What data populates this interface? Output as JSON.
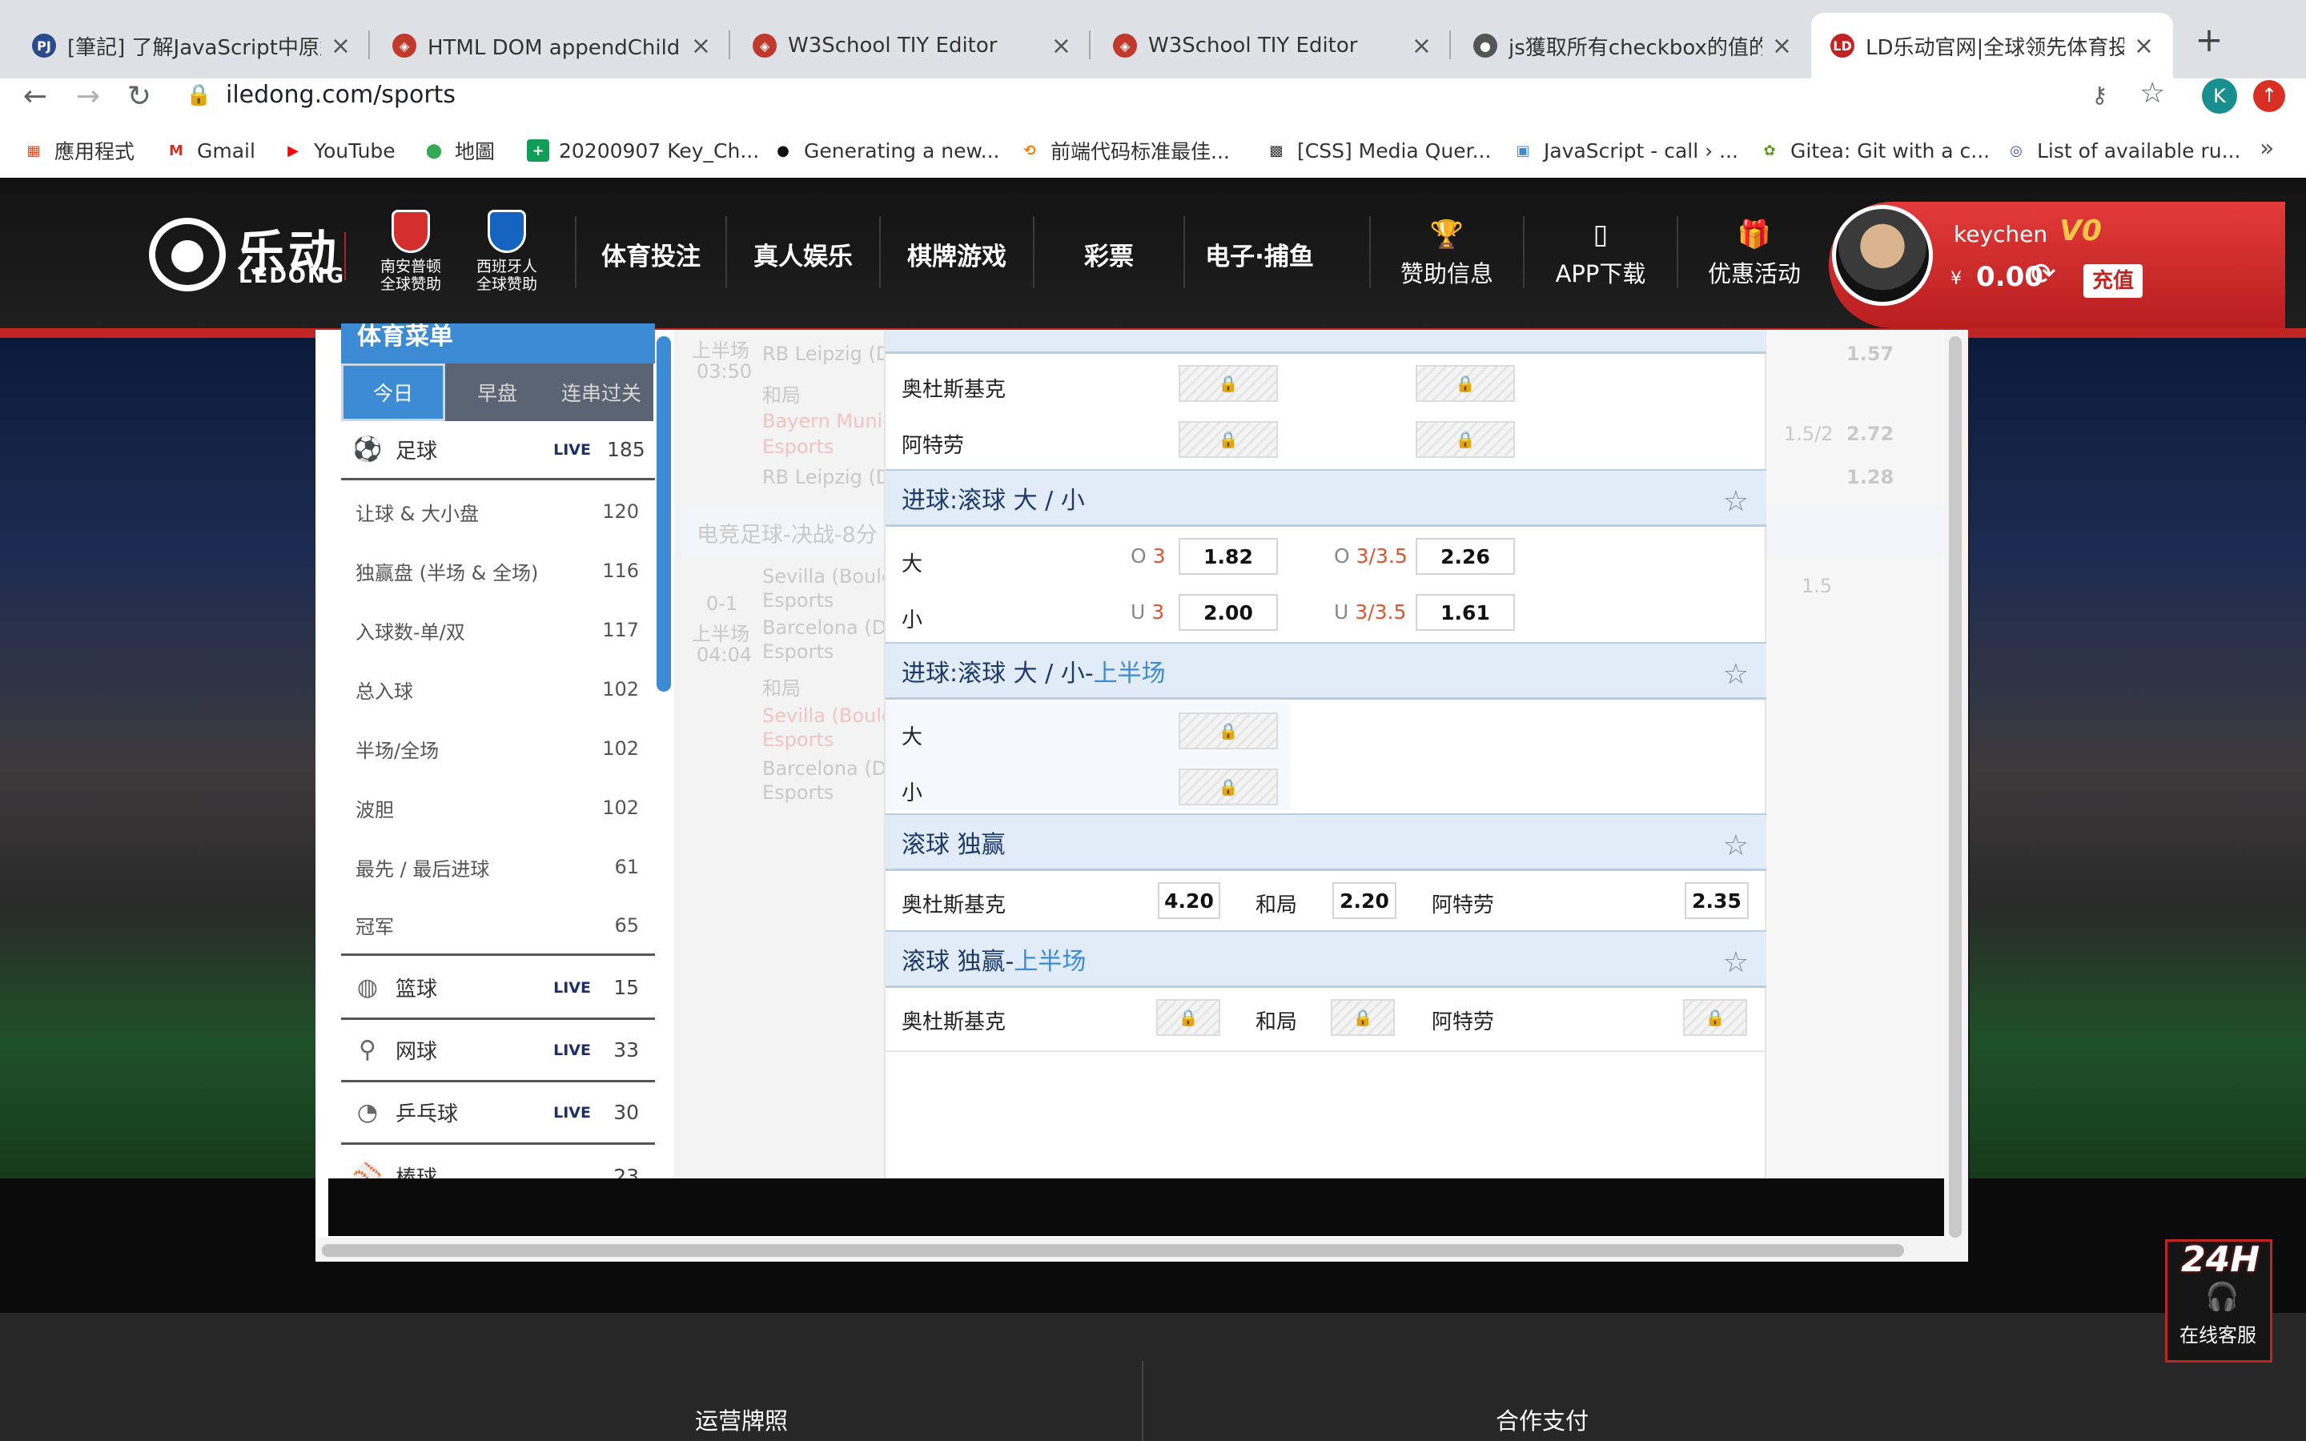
{
  "browser": {
    "tabs": [
      {
        "title": "[筆記] 了解JavaScript中原型(",
        "favicon": "PJ",
        "color": "#2a4b8d"
      },
      {
        "title": "HTML DOM appendChild() 方",
        "favicon": "◈",
        "color": "#c0392b"
      },
      {
        "title": "W3School TIY Editor",
        "favicon": "◈",
        "color": "#c0392b"
      },
      {
        "title": "W3School TIY Editor",
        "favicon": "◈",
        "color": "#c0392b"
      },
      {
        "title": "js獲取所有checkbox的值的簡",
        "favicon": "●",
        "color": "#555555"
      },
      {
        "title": "LD乐动官网|全球领先体育投注",
        "favicon": "LD",
        "color": "#c22323"
      }
    ],
    "new_tab": "+",
    "url": "iledong.com/sports",
    "profile_initial": "K",
    "bookmarks": [
      {
        "label": "應用程式",
        "icon": "▦",
        "color": "#e64a19"
      },
      {
        "label": "Gmail",
        "icon": "M",
        "color": "#d93025"
      },
      {
        "label": "YouTube",
        "icon": "▶",
        "color": "#ff0000"
      },
      {
        "label": "地圖",
        "icon": "⬤",
        "color": "#34a853"
      },
      {
        "label": "20200907 Key_Ch...",
        "icon": "+",
        "color": "#0f9d58"
      },
      {
        "label": "Generating a new...",
        "icon": "●",
        "color": "#111111"
      },
      {
        "label": "前端代码标准最佳...",
        "icon": "⟲",
        "color": "#f57c00"
      },
      {
        "label": "[CSS] Media Quer...",
        "icon": "▩",
        "color": "#333333"
      },
      {
        "label": "JavaScript - call › ...",
        "icon": "▣",
        "color": "#3d8bd4"
      },
      {
        "label": "Gitea: Git with a c...",
        "icon": "✿",
        "color": "#609926"
      },
      {
        "label": "List of available ru...",
        "icon": "◎",
        "color": "#3f51b5"
      }
    ],
    "bookmarks_more": "»"
  },
  "header": {
    "logo_cn": "乐动",
    "logo_en": "LEDONG",
    "sponsors": [
      {
        "label1": "南安普顿",
        "label2": "全球赞助",
        "color": "#d32f2f"
      },
      {
        "label1": "西班牙人",
        "label2": "全球赞助",
        "color": "#1565c0"
      }
    ],
    "nav": [
      "体育投注",
      "真人娱乐",
      "棋牌游戏",
      "彩票",
      "电子·捕鱼"
    ],
    "icon_nav": [
      {
        "label": "赞助信息",
        "icon": "🏆"
      },
      {
        "label": "APP下载",
        "icon": "▯"
      },
      {
        "label": "优惠活动",
        "icon": "🎁"
      }
    ],
    "user": {
      "name": "keychen",
      "vip": "V0",
      "currency": "¥",
      "balance": "0.00",
      "recharge": "充值"
    }
  },
  "sidebar": {
    "title": "体育菜单",
    "tabs": [
      "今日",
      "早盘",
      "连串过关"
    ],
    "sports": [
      {
        "name": "足球",
        "live": "LIVE",
        "count": "185",
        "icon": "⚽"
      },
      {
        "name": "篮球",
        "live": "LIVE",
        "count": "15",
        "icon": "◍"
      },
      {
        "name": "网球",
        "live": "LIVE",
        "count": "33",
        "icon": "⚲"
      },
      {
        "name": "乒乓球",
        "live": "LIVE",
        "count": "30",
        "icon": "◔"
      },
      {
        "name": "棒球",
        "live": "",
        "count": "23",
        "icon": "⚾"
      }
    ],
    "football_markets": [
      {
        "name": "让球 & 大小盘",
        "count": "120"
      },
      {
        "name": "独赢盘 (半场 & 全场)",
        "count": "116"
      },
      {
        "name": "入球数-单/双",
        "count": "117"
      },
      {
        "name": "总入球",
        "count": "102"
      },
      {
        "name": "半场/全场",
        "count": "102"
      },
      {
        "name": "波胆",
        "count": "102"
      },
      {
        "name": "最先 / 最后进球",
        "count": "61"
      },
      {
        "name": "冠军",
        "count": "65"
      }
    ]
  },
  "ghost_list": {
    "items": [
      "上半场",
      "03:50",
      "RB Leipzig (D",
      "和局",
      "Bayern Munic",
      "Esports",
      "RB Leipzig (D",
      "电竞足球-决战-8分",
      "Sevilla (Boule",
      "Esports",
      "0-1",
      "上半场",
      "04:04",
      "Barcelona (D",
      "Esports",
      "和局",
      "Sevilla (Boule",
      "Esports",
      "Barcelona (D",
      "Esports"
    ],
    "right_values": [
      "1.57",
      "1.5/2",
      "2.72",
      "1.28",
      "1.5"
    ]
  },
  "markets": {
    "team_home": "奥杜斯基克",
    "team_away": "阿特劳",
    "draw": "和局",
    "ou_live": {
      "title": "进球:滚球 大 / 小",
      "over": "大",
      "under": "小",
      "rows": [
        {
          "p1": "O",
          "l1": "3",
          "o1": "1.82",
          "p2": "O",
          "l2": "3/3.5",
          "o2": "2.26"
        },
        {
          "p1": "U",
          "l1": "3",
          "o1": "2.00",
          "p2": "U",
          "l2": "3/3.5",
          "o2": "1.61"
        }
      ]
    },
    "ou_first_half": {
      "title": "进球:滚球 大 / 小-",
      "highlight": "上半场",
      "over": "大",
      "under": "小"
    },
    "moneyline": {
      "title": "滚球 独赢",
      "home_odds": "4.20",
      "draw_odds": "2.20",
      "away_odds": "2.35"
    },
    "moneyline_first_half": {
      "title": "滚球 独赢-",
      "highlight": "上半场"
    }
  },
  "footer": {
    "col1": "运营牌照",
    "col2": "合作支付"
  },
  "customer_service": {
    "badge": "24H",
    "label": "在线客服",
    "icon": "🎧"
  }
}
